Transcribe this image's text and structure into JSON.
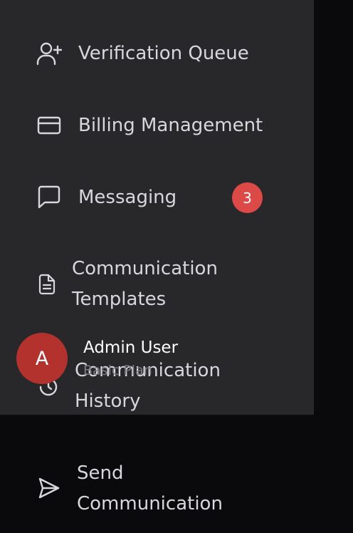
{
  "nav": {
    "items": [
      {
        "id": "verification-queue",
        "icon": "user-plus-icon",
        "label_lines": [
          "Verification Queue"
        ],
        "badge": ""
      },
      {
        "id": "billing-management",
        "icon": "credit-card-icon",
        "label_lines": [
          "Billing Management"
        ],
        "badge": ""
      },
      {
        "id": "messaging",
        "icon": "message-square-icon",
        "label_lines": [
          "Messaging"
        ],
        "badge": "3"
      },
      {
        "id": "communication-templates",
        "icon": "file-text-icon",
        "label_lines": [
          "Communication",
          "Templates"
        ],
        "badge": ""
      },
      {
        "id": "communication-history",
        "icon": "history-icon",
        "label_lines": [
          "Communication",
          "History"
        ],
        "badge": ""
      },
      {
        "id": "send-communication",
        "icon": "send-icon",
        "label_lines": [
          "Send",
          "Communication"
        ],
        "badge": ""
      }
    ]
  },
  "user": {
    "avatar_initial": "A",
    "name": "Admin User",
    "plan": "Basic Plan"
  },
  "colors": {
    "panel": "#28282b",
    "page": "#0a0a0c",
    "badge": "#dc4a47",
    "avatar": "#b3322e",
    "text": "#d8d8dc"
  }
}
